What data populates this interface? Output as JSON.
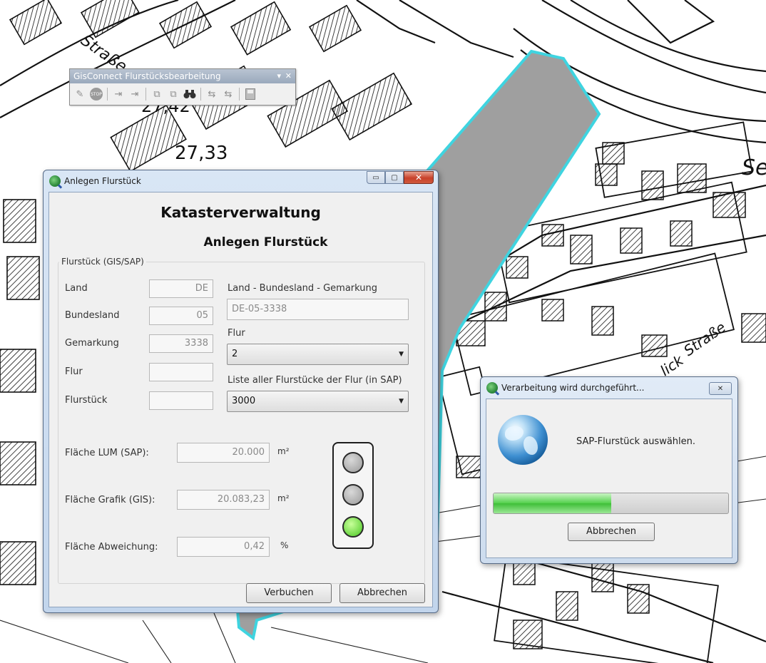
{
  "map": {
    "labels": [
      {
        "id": "strasse-top",
        "text": "Straße"
      },
      {
        "id": "z2742",
        "text": "27,42"
      },
      {
        "id": "z2733",
        "text": "27,33"
      },
      {
        "id": "se",
        "text": "Se"
      },
      {
        "id": "strasse-right",
        "text": "Straße"
      },
      {
        "id": "lick",
        "text": "lick"
      }
    ],
    "parcel_color": "#9f9f9f",
    "parcel_outline_color": "#3fd4e0"
  },
  "toolbar": {
    "title": "GisConnect Flurstücksbearbeitung",
    "pin_glyph": "▾",
    "close_glyph": "✕",
    "icons": [
      "pencil-icon",
      "stop-icon",
      "arrow-right-icon",
      "arrow-right-alt-icon",
      "layer-icon",
      "layer-alt-icon",
      "binoculars-icon",
      "exchange-sap-icon",
      "exchange-sap-alt-icon",
      "save-icon"
    ],
    "icon_glyphs": {
      "pencil": "✎",
      "stop": "STOP",
      "arrow_right": "⇥",
      "arrow_right_alt": "⇥",
      "layer": "⧉",
      "layer_alt": "⧉",
      "binoculars": "👓",
      "exchange": "⇆",
      "exchange_alt": "⇆",
      "save": "🖫"
    }
  },
  "dialog_main": {
    "title": "Anlegen Flurstück",
    "heading": "Katasterverwaltung",
    "subheading": "Anlegen Flurstück",
    "caption_buttons": {
      "minimize": "▭",
      "maximize": "▢",
      "close": "✕"
    },
    "group_label": "Flurstück (GIS/SAP)",
    "labels": {
      "land": "Land",
      "bundesland": "Bundesland",
      "gemarkung": "Gemarkung",
      "flur": "Flur",
      "flurstueck": "Flurstück",
      "combo_header": "Land - Bundesland - Gemarkung",
      "flur_combo_label": "Flur",
      "list_label": "Liste aller Flurstücke der Flur (in SAP)",
      "flaeche_lum": "Fläche LUM (SAP):",
      "flaeche_grafik": "Fläche Grafik (GIS):",
      "flaeche_abweichung": "Fläche Abweichung:"
    },
    "values": {
      "land": "DE",
      "bundesland": "05",
      "gemarkung": "3338",
      "flur": "",
      "flurstueck": "",
      "combo_value": "DE-05-3338",
      "flur_selected": "2",
      "list_selected": "3000",
      "flaeche_lum": "20.000",
      "flaeche_grafik": "20.083,23",
      "flaeche_abweichung": "0,42"
    },
    "units": {
      "m2": "m²",
      "percent": "%"
    },
    "traffic_light": {
      "red": "off",
      "yellow": "off",
      "green": "on",
      "on_color": "#6fd846"
    },
    "buttons": {
      "verbuchen": "Verbuchen",
      "abbrechen": "Abbrechen"
    },
    "dropdown_glyph": "▼"
  },
  "dialog_progress": {
    "title": "Verarbeitung wird durchgeführt...",
    "close_glyph": "✕",
    "message": "SAP-Flurstück auswählen.",
    "progress_fraction": 0.5,
    "cancel_label": "Abbrechen"
  }
}
